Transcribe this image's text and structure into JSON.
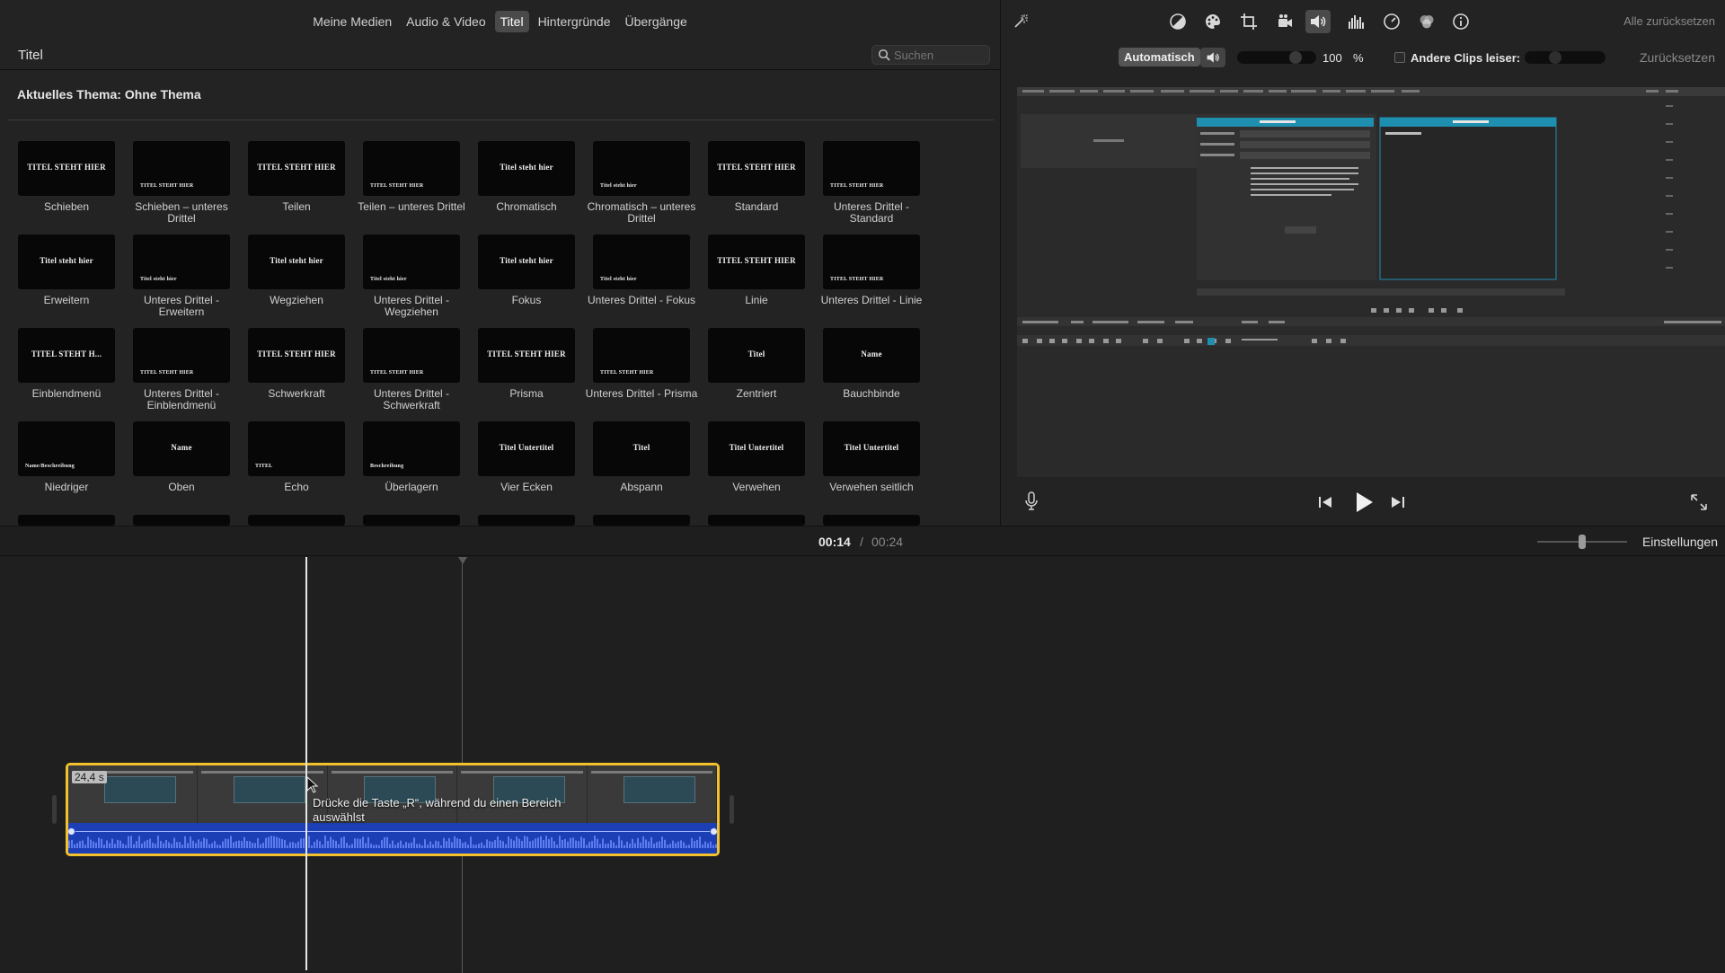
{
  "browser": {
    "tabs": [
      {
        "label": "Meine Medien",
        "active": false
      },
      {
        "label": "Audio & Video",
        "active": false
      },
      {
        "label": "Titel",
        "active": true
      },
      {
        "label": "Hintergründe",
        "active": false
      },
      {
        "label": "Übergänge",
        "active": false
      }
    ],
    "section_title": "Titel",
    "search_placeholder": "Suchen",
    "theme_label": "Aktuelles Thema: Ohne Thema",
    "tiles": [
      {
        "label": "Schieben",
        "thumb": "TITEL STEHT HIER"
      },
      {
        "label": "Schieben – unteres Drittel",
        "thumb": "TITEL STEHT HIER"
      },
      {
        "label": "Teilen",
        "thumb": "TITEL STEHT HIER"
      },
      {
        "label": "Teilen – unteres Drittel",
        "thumb": "TITEL STEHT HIER"
      },
      {
        "label": "Chromatisch",
        "thumb": "Titel steht hier"
      },
      {
        "label": "Chromatisch – unteres Drittel",
        "thumb": "Titel steht hier"
      },
      {
        "label": "Standard",
        "thumb": "TITEL STEHT HIER"
      },
      {
        "label": "Unteres Drittel - Standard",
        "thumb": "TITEL STEHT HIER"
      },
      {
        "label": "Erweitern",
        "thumb": "Titel steht hier"
      },
      {
        "label": "Unteres Drittel - Erweitern",
        "thumb": "Titel steht hier"
      },
      {
        "label": "Wegziehen",
        "thumb": "Titel steht hier"
      },
      {
        "label": "Unteres Drittel - Wegziehen",
        "thumb": "Titel steht hier"
      },
      {
        "label": "Fokus",
        "thumb": "Titel steht hier"
      },
      {
        "label": "Unteres Drittel - Fokus",
        "thumb": "Titel steht hier"
      },
      {
        "label": "Linie",
        "thumb": "TITEL STEHT HIER"
      },
      {
        "label": "Unteres Drittel - Linie",
        "thumb": "TITEL STEHT HIER"
      },
      {
        "label": "Einblendmenü",
        "thumb": "TITEL STEHT H..."
      },
      {
        "label": "Unteres Drittel - Einblendmenü",
        "thumb": "TITEL STEHT HIER"
      },
      {
        "label": "Schwerkraft",
        "thumb": "TITEL STEHT HIER"
      },
      {
        "label": "Unteres Drittel - Schwerkraft",
        "thumb": "TITEL STEHT HIER"
      },
      {
        "label": "Prisma",
        "thumb": "TITEL STEHT HIER"
      },
      {
        "label": "Unteres Drittel - Prisma",
        "thumb": "TITEL STEHT HIER"
      },
      {
        "label": "Zentriert",
        "thumb": "Titel"
      },
      {
        "label": "Bauchbinde",
        "thumb": "Name"
      },
      {
        "label": "Niedriger",
        "thumb": "Name/Beschreibung"
      },
      {
        "label": "Oben",
        "thumb": "Name"
      },
      {
        "label": "Echo",
        "thumb": "TITEL"
      },
      {
        "label": "Überlagern",
        "thumb": "Beschreibung"
      },
      {
        "label": "Vier Ecken",
        "thumb": "Titel Untertitel"
      },
      {
        "label": "Abspann",
        "thumb": "Titel"
      },
      {
        "label": "Verwehen",
        "thumb": "Titel Untertitel"
      },
      {
        "label": "Verwehen seitlich",
        "thumb": "Titel Untertitel"
      }
    ]
  },
  "viewer": {
    "reset_all": "Alle zurücksetzen",
    "auto_button": "Automatisch",
    "volume_value": "100",
    "volume_unit": "%",
    "volume_level": 0.78,
    "other_clips_label": "Andere Clips leiser:",
    "other_clips_level": 0.35,
    "reset_button": "Zurücksetzen",
    "adjust_icons": [
      "magic-wand-icon",
      "color-balance-icon",
      "color-correction-icon",
      "crop-icon",
      "stabilization-icon",
      "volume-icon",
      "equalizer-icon",
      "speed-icon",
      "filter-icon",
      "info-icon"
    ]
  },
  "timeline": {
    "time_current": "00:14",
    "time_separator": "/",
    "time_total": "00:24",
    "settings_label": "Einstellungen",
    "zoom_level": 0.5,
    "clip_duration": "24,4 s",
    "tooltip": "Drücke die Taste „R“, während du einen Bereich auswählst"
  },
  "colors": {
    "clip_border": "#f3c12c",
    "audio_track": "#1c3fb6",
    "preview_accent": "#1f8fb0"
  }
}
